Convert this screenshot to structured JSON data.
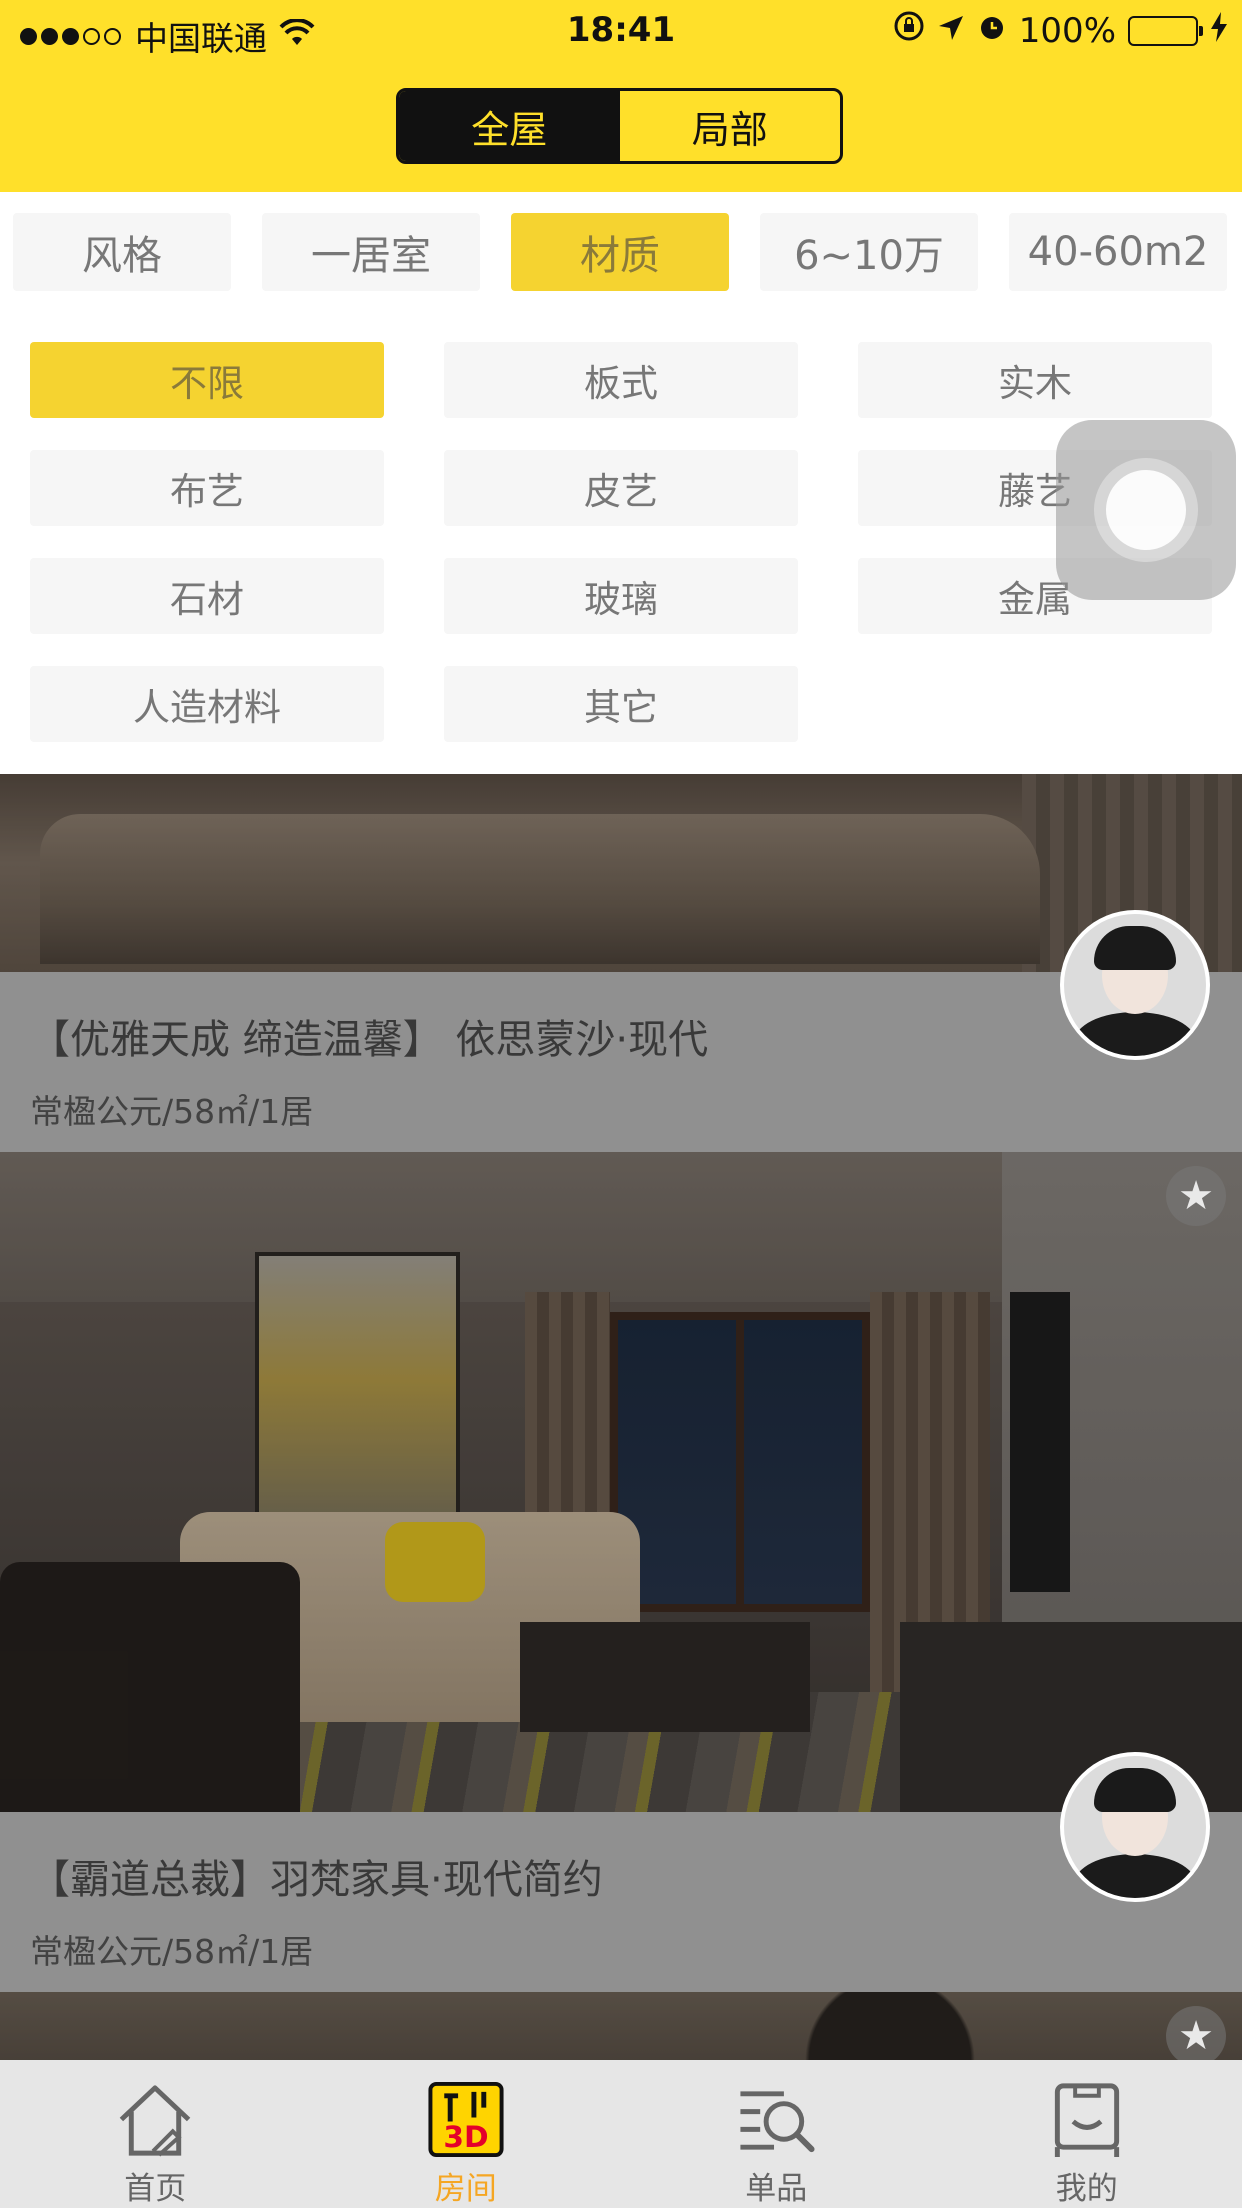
{
  "status_bar": {
    "carrier": "中国联通",
    "time": "18:41",
    "battery": "100%",
    "battery_level": 1.0
  },
  "segment": {
    "options": [
      "全屋",
      "局部"
    ],
    "selected": "全屋"
  },
  "filter_chips": {
    "items": [
      "风格",
      "一居室",
      "材质",
      "6~10万",
      "40-60m2"
    ],
    "selected": "材质"
  },
  "material_options": {
    "items": [
      "不限",
      "板式",
      "实木",
      "布艺",
      "皮艺",
      "藤艺",
      "石材",
      "玻璃",
      "金属",
      "人造材料",
      "其它"
    ],
    "selected": "不限"
  },
  "listings": [
    {
      "title": "【优雅天成 缔造温馨】 依思蒙沙·现代",
      "meta": "常楹公元/58㎡/1居"
    },
    {
      "title": "【霸道总裁】羽梵家具·现代简约",
      "meta": "常楹公元/58㎡/1居"
    }
  ],
  "tab_bar": {
    "items": [
      {
        "label": "首页",
        "icon": "house-icon"
      },
      {
        "label": "房间",
        "icon": "room-3d-icon"
      },
      {
        "label": "单品",
        "icon": "search-list-icon"
      },
      {
        "label": "我的",
        "icon": "profile-box-icon"
      }
    ],
    "active": "房间"
  },
  "colors": {
    "brand_yellow": "#ffe02a",
    "chip_active": "#f5d330",
    "tab_active": "#f5a623"
  }
}
